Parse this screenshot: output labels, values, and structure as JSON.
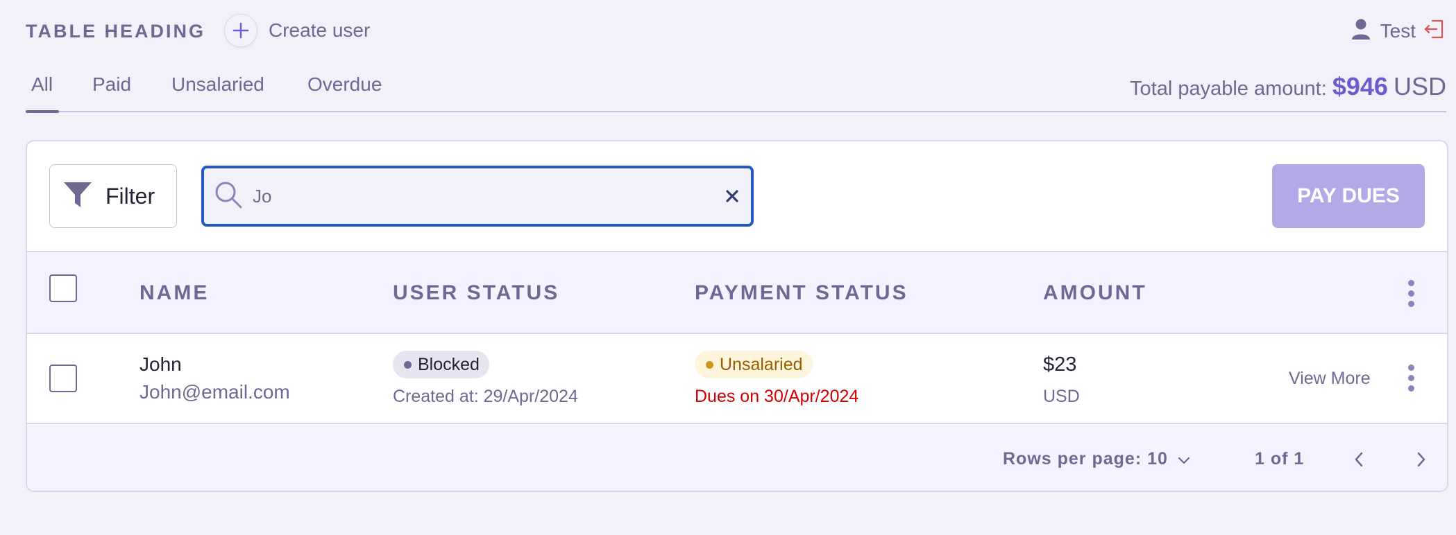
{
  "header": {
    "title": "TABLE HEADING",
    "create_user_label": "Create user",
    "user_name": "Test"
  },
  "tabs": [
    {
      "label": "All",
      "active": true
    },
    {
      "label": "Paid",
      "active": false
    },
    {
      "label": "Unsalaried",
      "active": false
    },
    {
      "label": "Overdue",
      "active": false
    }
  ],
  "summary": {
    "label": "Total payable amount:",
    "amount": "$946",
    "currency": "USD"
  },
  "toolbar": {
    "filter_label": "Filter",
    "search_value": "Jo",
    "pay_label": "PAY DUES"
  },
  "table": {
    "columns": [
      "NAME",
      "USER STATUS",
      "PAYMENT STATUS",
      "AMOUNT"
    ],
    "rows": [
      {
        "name": "John",
        "email": "John@email.com",
        "user_status": "Blocked",
        "created": "Created at: 29/Apr/2024",
        "payment_status": "Unsalaried",
        "due": "Dues on 30/Apr/2024",
        "amount": "$23",
        "currency": "USD",
        "action": "View More"
      }
    ]
  },
  "pagination": {
    "rows_per_page": "Rows per page: 10",
    "range": "1 of 1"
  },
  "colors": {
    "accent": "#6d5bd0",
    "primary_text": "#6e6893",
    "search_border": "#2658c4",
    "pay_button": "#b3a9e6",
    "due_text": "#d30000",
    "logout_icon": "#d9534f"
  },
  "icons": [
    "plus-icon",
    "user-icon",
    "logout-icon",
    "filter-icon",
    "search-icon",
    "close-icon",
    "kebab-icon",
    "chevron-down-icon",
    "chevron-left-icon",
    "chevron-right-icon"
  ]
}
